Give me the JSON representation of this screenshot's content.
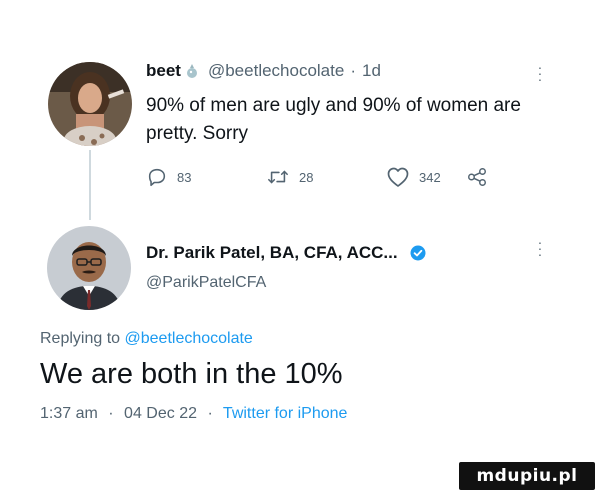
{
  "tweet1": {
    "display_name": "beet",
    "handle": "@beetlechocolate",
    "separator": "·",
    "timestamp": "1d",
    "text": "90% of men are ugly and 90% of women are pretty. Sorry",
    "badge_icon": "beet-emoji-icon",
    "actions": {
      "replies": "83",
      "retweets": "28",
      "likes": "342"
    }
  },
  "tweet2": {
    "display_name": "Dr. Parik Patel, BA, CFA, ACC...",
    "handle": "@ParikPatelCFA",
    "replying_prefix": "Replying to",
    "replying_mention": "@beetlechocolate",
    "text": "We are both in the 10%",
    "time": "1:37 am",
    "separator": "·",
    "date": "04 Dec 22",
    "source": "Twitter for iPhone"
  },
  "watermark": "mdupiu.pl",
  "colors": {
    "text_primary": "#0f1419",
    "text_secondary": "#536471",
    "accent_blue": "#1d9bf0",
    "thread_line": "#cfd9de",
    "background": "#ffffff"
  }
}
